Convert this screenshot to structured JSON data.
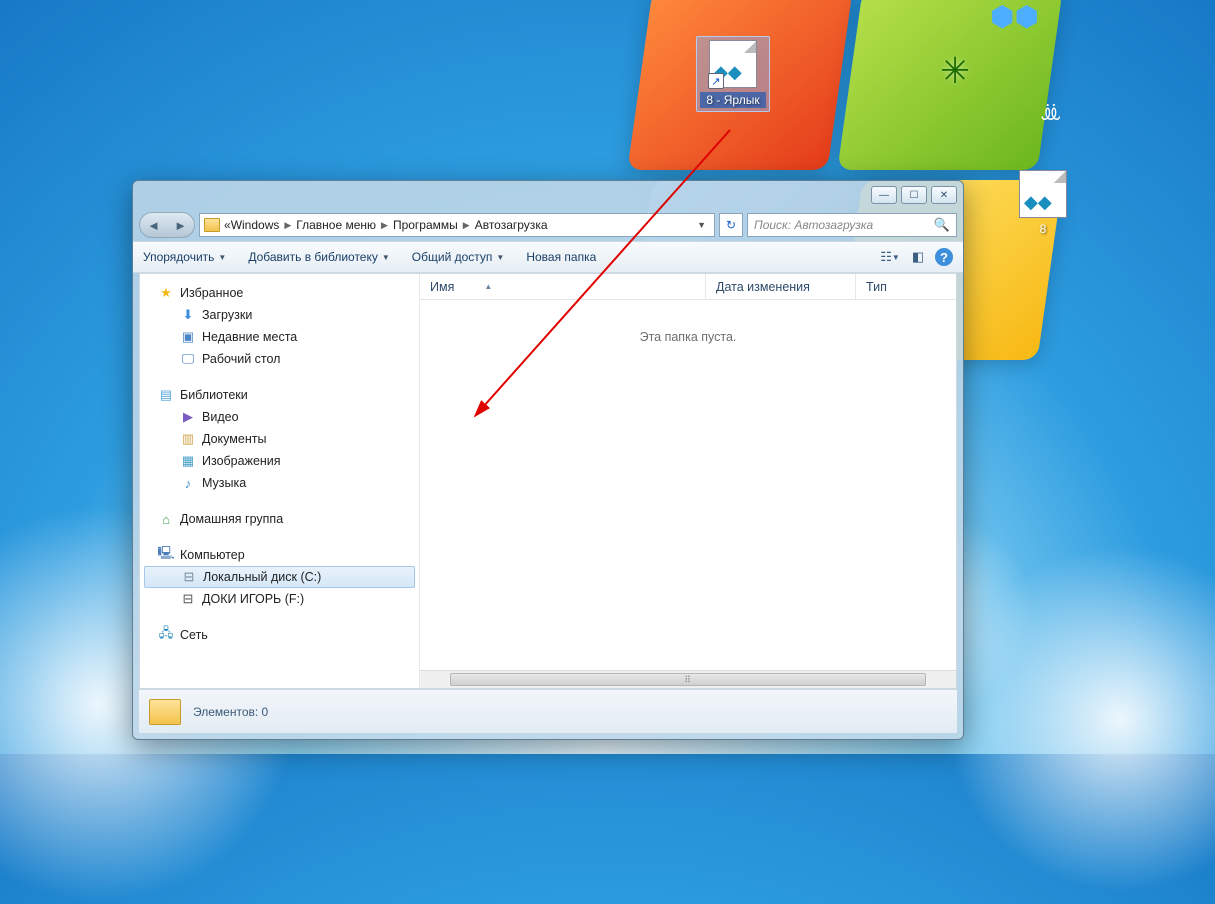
{
  "desktop": {
    "icon_shortcut": {
      "label": "8 - Ярлык"
    },
    "icon_original": {
      "label": "8"
    }
  },
  "window": {
    "controls": {
      "min": "—",
      "max": "☐",
      "close": "✕"
    },
    "breadcrumb": {
      "prefix": "«",
      "items": [
        "Windows",
        "Главное меню",
        "Программы",
        "Автозагрузка"
      ]
    },
    "search": {
      "placeholder": "Поиск: Автозагрузка"
    },
    "toolbar": {
      "organize": "Упорядочить",
      "add_library": "Добавить в библиотеку",
      "share": "Общий доступ",
      "new_folder": "Новая папка"
    },
    "nav": {
      "favorites": {
        "header": "Избранное",
        "items": [
          "Загрузки",
          "Недавние места",
          "Рабочий стол"
        ]
      },
      "libraries": {
        "header": "Библиотеки",
        "items": [
          "Видео",
          "Документы",
          "Изображения",
          "Музыка"
        ]
      },
      "homegroup": {
        "header": "Домашняя группа"
      },
      "computer": {
        "header": "Компьютер",
        "items": [
          "Локальный диск (C:)",
          "ДОКИ ИГОРЬ (F:)"
        ],
        "selected_index": 0
      },
      "network": {
        "header": "Сеть"
      }
    },
    "columns": {
      "name": "Имя",
      "date": "Дата изменения",
      "type": "Тип"
    },
    "empty_message": "Эта папка пуста.",
    "status": {
      "label": "Элементов:",
      "count": "0"
    }
  }
}
